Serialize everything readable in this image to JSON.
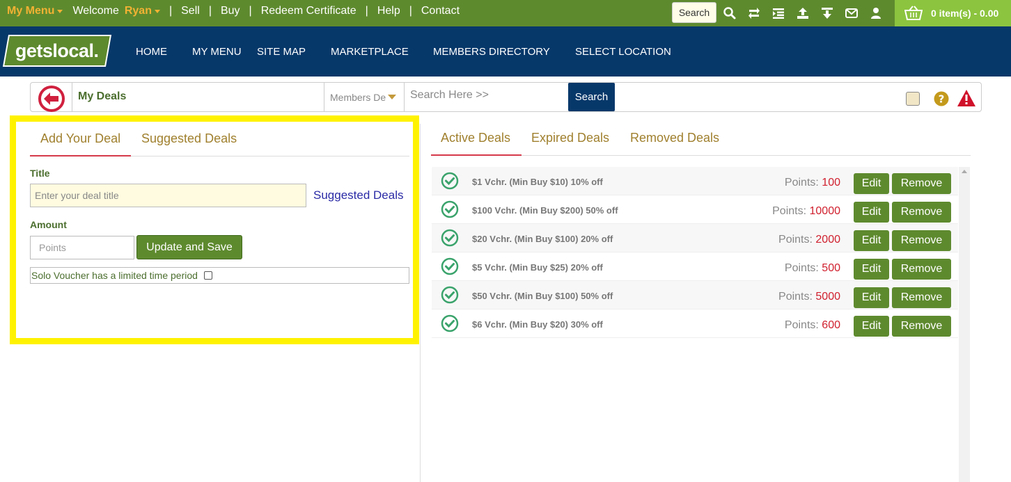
{
  "topbar": {
    "my_menu": "My Menu",
    "welcome": "Welcome",
    "user": "Ryan",
    "links": [
      "Sell",
      "Buy",
      "Redeem Certificate",
      "Help",
      "Contact"
    ],
    "search_label": "Search",
    "icons": [
      "search-icon",
      "refresh-icon",
      "indent-icon",
      "upload-icon",
      "download-icon",
      "envelope-icon",
      "user-icon"
    ],
    "cart": "0 item(s) - 0.00"
  },
  "nav": {
    "logo": "getslocal.",
    "links": [
      "HOME",
      "MY MENU",
      "SITE MAP",
      "MARKETPLACE",
      "MEMBERS DIRECTORY",
      "SELECT LOCATION"
    ]
  },
  "subheader": {
    "title": "My Deals",
    "members_select": "Members De",
    "search_placeholder": "Search Here >>",
    "search_button": "Search"
  },
  "left": {
    "tabs": [
      "Add Your Deal",
      "Suggested Deals"
    ],
    "title_label": "Title",
    "title_placeholder": "Enter your deal title",
    "suggested_link": "Suggested Deals",
    "amount_label": "Amount",
    "points_placeholder": "Points",
    "update_button": "Update and Save",
    "solo_label": "Solo Voucher has a limited time period"
  },
  "right": {
    "tabs": [
      "Active Deals",
      "Expired Deals",
      "Removed Deals"
    ],
    "points_label": "Points:",
    "edit_label": "Edit",
    "remove_label": "Remove",
    "deals": [
      {
        "name": "$1 Vchr. (Min Buy $10) 10% off",
        "points": "100"
      },
      {
        "name": "$100 Vchr. (Min Buy $200) 50% off",
        "points": "10000"
      },
      {
        "name": "$20 Vchr. (Min Buy $100) 20% off",
        "points": "2000"
      },
      {
        "name": "$5 Vchr. (Min Buy $25) 20% off",
        "points": "500"
      },
      {
        "name": "$50 Vchr. (Min Buy $100) 50% off",
        "points": "5000"
      },
      {
        "name": "$6 Vchr. (Min Buy $20) 30% off",
        "points": "600"
      }
    ]
  }
}
